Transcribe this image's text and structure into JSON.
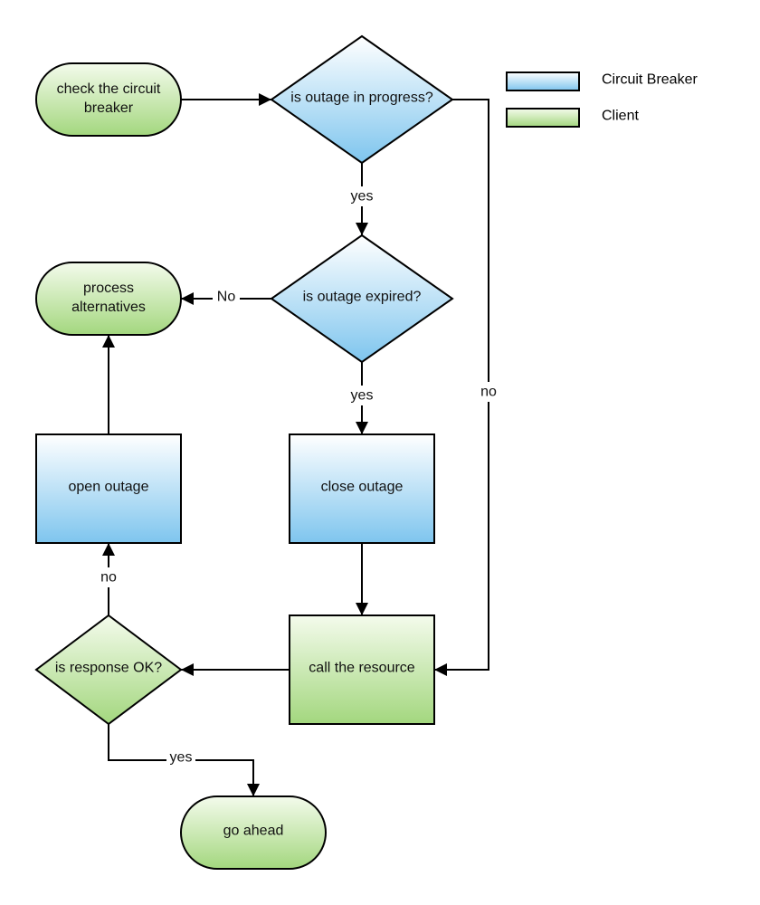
{
  "colors": {
    "circuit_breaker_top": "#ffffff",
    "circuit_breaker_bottom": "#7ec5ee",
    "client_top": "#f4fbec",
    "client_bottom": "#a3d77e",
    "stroke": "#000000"
  },
  "legend": [
    {
      "label": "Circuit Breaker",
      "role": "circuit-breaker"
    },
    {
      "label": "Client",
      "role": "client"
    }
  ],
  "nodes": {
    "check": {
      "line1": "check the circuit",
      "line2": "breaker",
      "shape": "terminator",
      "role": "client"
    },
    "outage_in_progress": {
      "label": "is outage in progress?",
      "shape": "decision",
      "role": "circuit-breaker"
    },
    "outage_expired": {
      "label": "is outage expired?",
      "shape": "decision",
      "role": "circuit-breaker"
    },
    "process_alternatives": {
      "line1": "process",
      "line2": "alternatives",
      "shape": "terminator",
      "role": "client"
    },
    "open_outage": {
      "label": "open outage",
      "shape": "process",
      "role": "circuit-breaker"
    },
    "close_outage": {
      "label": "close outage",
      "shape": "process",
      "role": "circuit-breaker"
    },
    "call_resource": {
      "label": "call the resource",
      "shape": "process",
      "role": "client"
    },
    "response_ok": {
      "label": "is response OK?",
      "shape": "decision",
      "role": "client"
    },
    "go_ahead": {
      "label": "go ahead",
      "shape": "terminator",
      "role": "client"
    }
  },
  "edges": {
    "check_to_progress": {
      "label": ""
    },
    "progress_yes": {
      "label": "yes"
    },
    "progress_no": {
      "label": "no"
    },
    "expired_no": {
      "label": "No"
    },
    "expired_yes": {
      "label": "yes"
    },
    "open_to_alternatives": {
      "label": ""
    },
    "close_to_call": {
      "label": ""
    },
    "call_to_response": {
      "label": ""
    },
    "response_no": {
      "label": "no"
    },
    "response_yes": {
      "label": "yes"
    }
  }
}
